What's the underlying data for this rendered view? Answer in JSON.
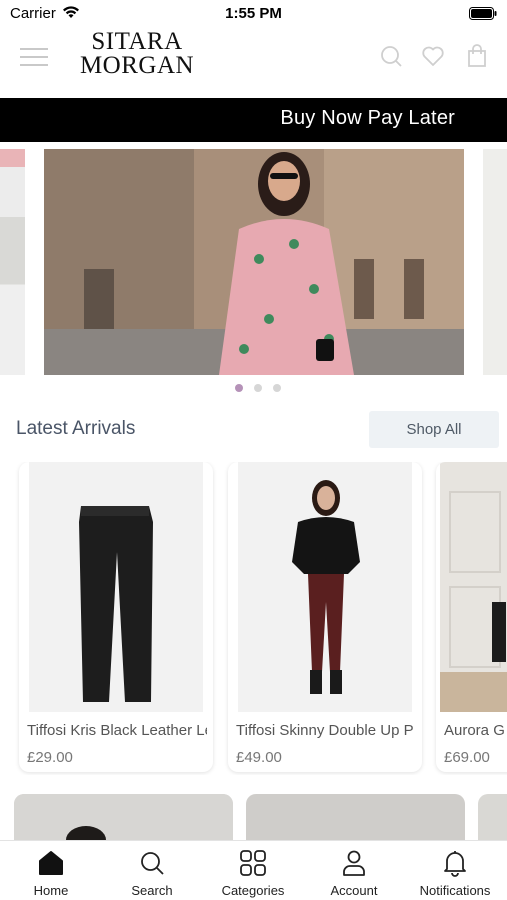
{
  "status_bar": {
    "carrier": "Carrier",
    "time": "1:55 PM"
  },
  "header": {
    "logo_line1": "SITARA",
    "logo_line2": "MORGAN",
    "icons": [
      "menu-icon",
      "search-icon",
      "heart-icon",
      "bag-icon"
    ]
  },
  "promo": {
    "text": "Buy Now Pay Later"
  },
  "carousel": {
    "slide_count": 3,
    "active_index": 0
  },
  "latest": {
    "title": "Latest Arrivals",
    "shop_all_label": "Shop All",
    "products": [
      {
        "name": "Tiffosi Kris Black Leather Le",
        "price": "£29.00"
      },
      {
        "name": "Tiffosi Skinny Double Up P",
        "price": "£49.00"
      },
      {
        "name": "Aurora G",
        "price": "£69.00"
      }
    ]
  },
  "tabbar": {
    "tabs": [
      {
        "label": "Home",
        "icon": "home-icon",
        "active": true
      },
      {
        "label": "Search",
        "icon": "search-icon",
        "active": false
      },
      {
        "label": "Categories",
        "icon": "grid-icon",
        "active": false
      },
      {
        "label": "Account",
        "icon": "user-icon",
        "active": false
      },
      {
        "label": "Notifications",
        "icon": "bell-icon",
        "active": false
      }
    ]
  },
  "colors": {
    "promo_bg": "#000000",
    "dot_active": "#b592b8",
    "dot_inactive": "#d6d6d6",
    "section_title": "#4a5567"
  }
}
